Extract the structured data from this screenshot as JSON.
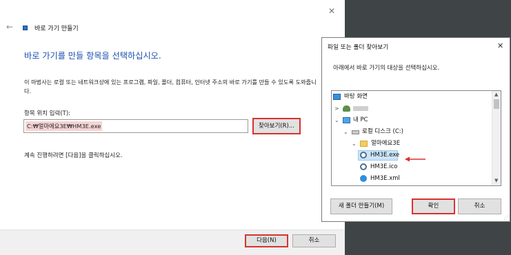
{
  "wizard": {
    "title": "바로 가기 만들기",
    "heading": "바로 가기를 만들 항목을 선택하십시오.",
    "description": "이 마법사는 로컬 또는 네트워크상에 있는 프로그램, 파일, 폴더, 컴퓨터, 인터넷 주소의 바로 가기를 만들 수 있도록 도와줍니다.",
    "location_label": "항목 위치 입력(T):",
    "location_value": "C:₩얼마에요3E₩HM3E.exe",
    "browse_label": "찾아보기(R)...",
    "continue_text": "계속 진행하려면 [다음]을 클릭하십시오.",
    "next_label": "다음(N)",
    "cancel_label": "취소"
  },
  "browse_dialog": {
    "title": "파일 또는 폴더 찾아보기",
    "message": "아래에서 바로 가기의 대상을 선택하십시오.",
    "tree": [
      {
        "label": "바탕 화면",
        "icon": "desktop-icon"
      },
      {
        "label": "",
        "icon": "user-icon"
      },
      {
        "label": "내 PC",
        "icon": "pc-icon"
      },
      {
        "label": "로컬 디스크 (C:)",
        "icon": "drive-icon"
      },
      {
        "label": "얼마에요3E",
        "icon": "folder-icon"
      },
      {
        "label": "HM3E.exe",
        "icon": "exe-icon",
        "selected": true
      },
      {
        "label": "HM3E.ico",
        "icon": "exe-icon"
      },
      {
        "label": "HM3E.xml",
        "icon": "xml-icon"
      }
    ],
    "new_folder_label": "새 폴더 만들기(M)",
    "ok_label": "확인",
    "cancel_label": "취소"
  },
  "colors": {
    "highlight": "#d7322e",
    "heading": "#1c4fb0",
    "selection": "#cce4f7"
  }
}
